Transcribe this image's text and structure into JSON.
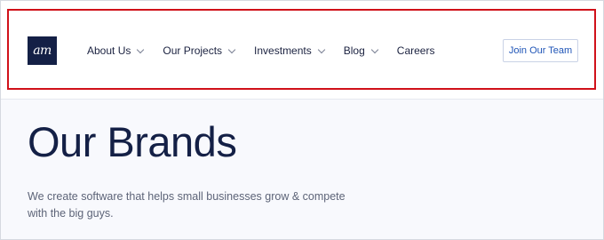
{
  "logo": {
    "text": "am"
  },
  "nav": {
    "items": [
      {
        "label": "About Us",
        "has_dropdown": true
      },
      {
        "label": "Our Projects",
        "has_dropdown": true
      },
      {
        "label": "Investments",
        "has_dropdown": true
      },
      {
        "label": "Blog",
        "has_dropdown": true
      },
      {
        "label": "Careers",
        "has_dropdown": false
      }
    ]
  },
  "cta": {
    "label": "Join Our Team"
  },
  "hero": {
    "title": "Our Brands",
    "subtitle": "We create software that helps small businesses grow & compete with the big guys."
  },
  "colors": {
    "brand_navy": "#142046",
    "link_blue": "#1f55b7",
    "highlight_red": "#d0111a",
    "page_bg": "#f8f9fd"
  },
  "icons": {
    "dropdown": "chevron-down-icon"
  }
}
